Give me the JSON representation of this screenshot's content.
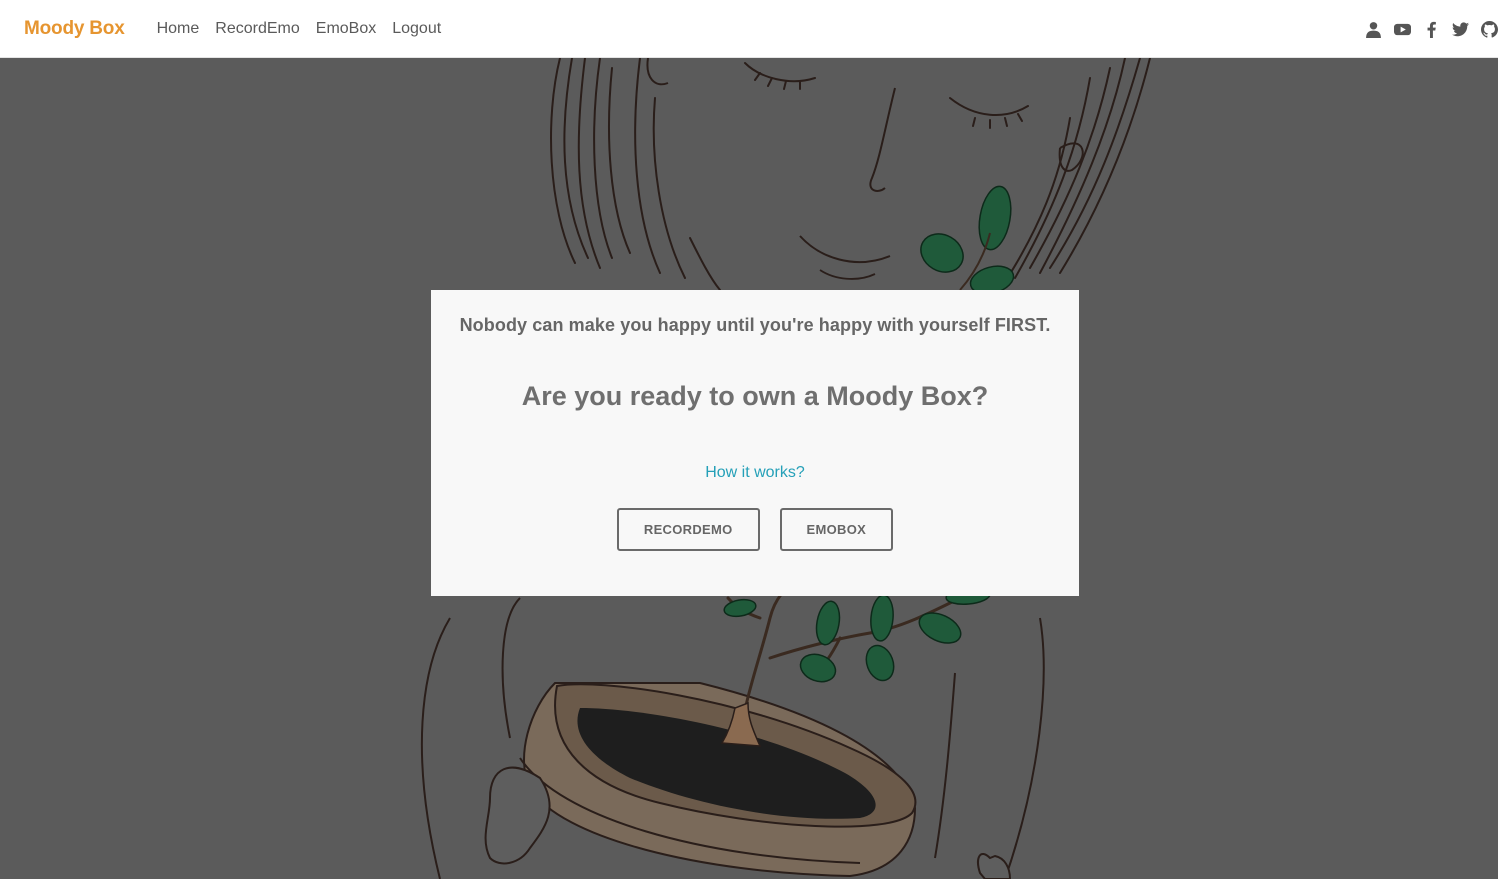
{
  "nav": {
    "brand": "Moody Box",
    "links": [
      "Home",
      "RecordEmo",
      "EmoBox",
      "Logout"
    ],
    "icons": [
      "user-icon",
      "youtube-icon",
      "facebook-icon",
      "twitter-icon",
      "github-icon"
    ]
  },
  "card": {
    "quote": "Nobody can make you happy until you're happy with yourself FIRST.",
    "question": "Are you ready to own a Moody Box?",
    "how_link": "How it works?",
    "buttons": [
      "RECORDEMO",
      "EMOBOX"
    ]
  },
  "colors": {
    "brand": "#e69530",
    "link": "#25a0b8",
    "overlay": "#5b5b5b",
    "card": "#f8f8f8"
  }
}
